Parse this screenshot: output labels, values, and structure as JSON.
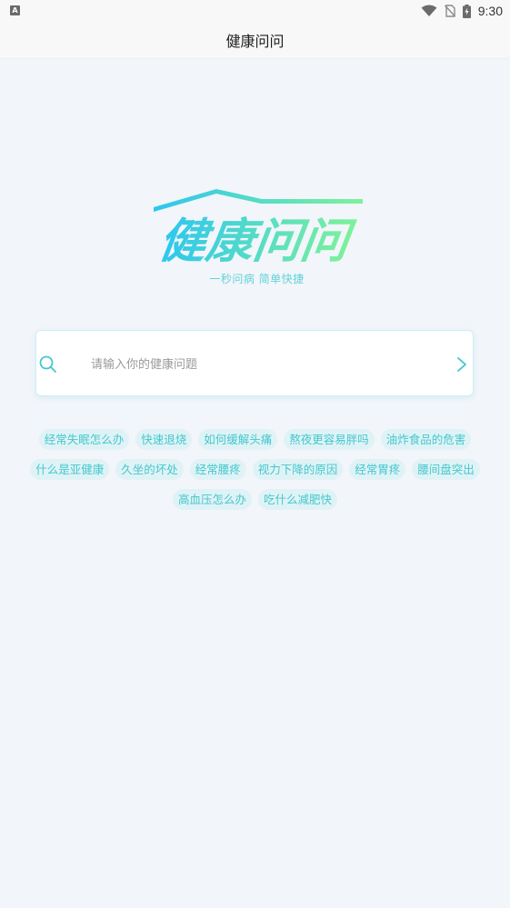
{
  "status_bar": {
    "time": "9:30",
    "left_icon": "A"
  },
  "header": {
    "title": "健康问问"
  },
  "logo": {
    "text": "健康问问",
    "slogan": "一秒问病 简单快捷",
    "gradient": [
      "#2cc6f0",
      "#7ef29a"
    ]
  },
  "search": {
    "placeholder": "请输入你的健康问题",
    "value": "",
    "icon": "search-icon",
    "submit_icon": "chevron-right-icon",
    "accent": "#45c7ce"
  },
  "tags": [
    "经常失眠怎么办",
    "快速退烧",
    "如何缓解头痛",
    "熬夜更容易胖吗",
    "油炸食品的危害",
    "什么是亚健康",
    "久坐的坏处",
    "经常腰疼",
    "视力下降的原因",
    "经常胃疼",
    "腰间盘突出",
    "高血压怎么办",
    "吃什么减肥快"
  ]
}
